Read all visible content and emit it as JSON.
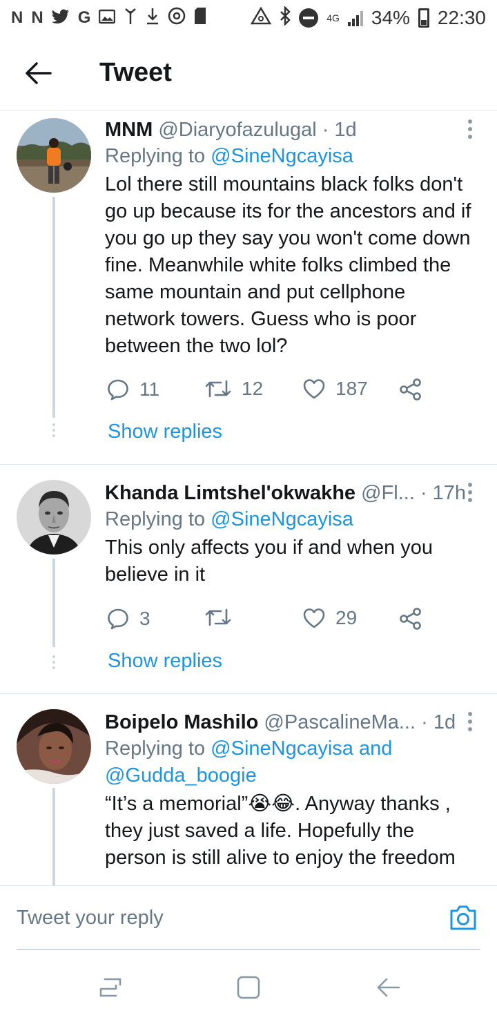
{
  "status_bar": {
    "left_icons": [
      "N",
      "N",
      "twitter-bird",
      "G",
      "gallery",
      "antenna",
      "download",
      "sync",
      "sd-card"
    ],
    "network": "4G",
    "battery_percent": "34%",
    "time": "22:30"
  },
  "header": {
    "title": "Tweet"
  },
  "tweets": [
    {
      "name": "MNM",
      "handle": "@Diaryofazulugal",
      "time": "· 1d",
      "replying_prefix": "Replying to ",
      "replying_to": "@SineNgcayisa",
      "replying_to_2": "",
      "text": "Lol there still mountains black folks don't go up because its for the ancestors and if you go up they say you won't come down fine.  Meanwhile white folks climbed the same mountain and put cellphone network towers. Guess who is poor between the two lol?",
      "replies": "11",
      "retweets": "12",
      "likes": "187",
      "show_replies": "Show replies"
    },
    {
      "name": "Khanda Limtshel'okwakhe",
      "handle": "@Fl...",
      "time": "· 17h",
      "replying_prefix": "Replying to ",
      "replying_to": "@SineNgcayisa",
      "replying_to_2": "",
      "text": "This only affects you if and when you believe in it",
      "replies": "3",
      "retweets": "",
      "likes": "29",
      "show_replies": "Show replies"
    },
    {
      "name": "Boipelo Mashilo",
      "handle": "@PascalineMa...",
      "time": "· 1d",
      "replying_prefix": "Replying to ",
      "replying_to": "@SineNgcayisa and",
      "replying_to_2": "@Gudda_boogie",
      "text": "“It’s a memorial”😭😂. Anyway thanks , they just saved a life. Hopefully the person is still alive to enjoy the freedom"
    }
  ],
  "composer": {
    "placeholder": "Tweet your reply"
  },
  "colors": {
    "accent": "#1b95e0",
    "muted": "#657786",
    "divider": "#e1e8ed"
  }
}
